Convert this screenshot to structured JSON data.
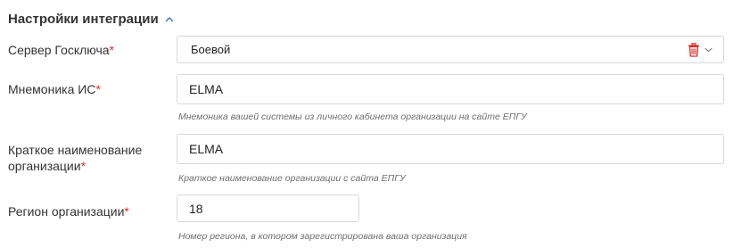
{
  "section": {
    "title": "Настройки интеграции",
    "collapse_icon": "chevron-up-icon",
    "accent_color": "#3e7bc4"
  },
  "required_marker": "*",
  "required_color": "#d0342c",
  "fields": {
    "server": {
      "label": "Сервер Госключа",
      "value": "Боевой",
      "clear_icon": "trash-icon",
      "clear_icon_color": "#d0342c",
      "dropdown_icon": "chevron-down-icon"
    },
    "mnemonic": {
      "label": "Мнемоника ИС",
      "value": "ELMA",
      "hint": "Мнемоника вашей системы из личного кабинета организации на сайте ЕПГУ"
    },
    "org_short_name": {
      "label_line1": "Краткое наименование",
      "label_line2": "организации",
      "value": "ELMA",
      "hint": "Краткое наименование организации с сайта ЕПГУ"
    },
    "region": {
      "label": "Регион организации",
      "value": "18",
      "hint": "Номер региона, в котором зарегистрирована ваша организация"
    }
  }
}
